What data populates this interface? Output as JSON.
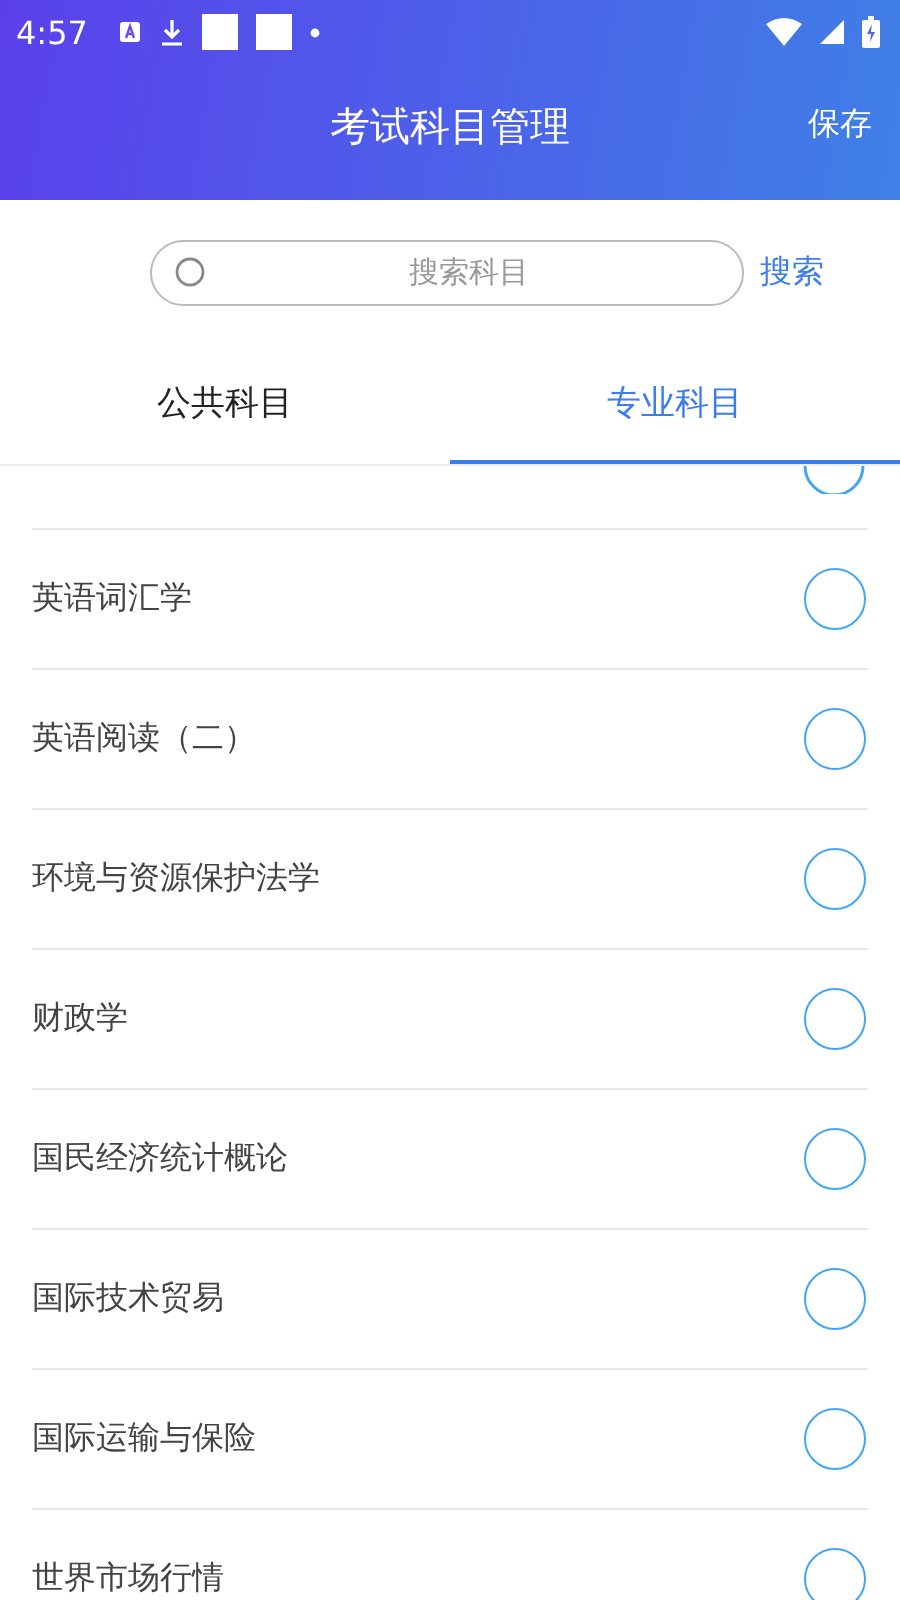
{
  "status_bar": {
    "time": "4:57"
  },
  "header": {
    "title": "考试科目管理",
    "action": "保存"
  },
  "search": {
    "placeholder": "搜索科目",
    "button": "搜索"
  },
  "tabs": [
    {
      "label": "公共科目",
      "selected": false
    },
    {
      "label": "专业科目",
      "selected": true
    }
  ],
  "subjects": [
    {
      "name": "英语词汇学",
      "selected": false
    },
    {
      "name": "英语阅读（二）",
      "selected": false
    },
    {
      "name": "环境与资源保护法学",
      "selected": false
    },
    {
      "name": "财政学",
      "selected": false
    },
    {
      "name": "国民经济统计概论",
      "selected": false
    },
    {
      "name": "国际技术贸易",
      "selected": false
    },
    {
      "name": "国际运输与保险",
      "selected": false
    },
    {
      "name": "世界市场行情",
      "selected": false
    }
  ]
}
